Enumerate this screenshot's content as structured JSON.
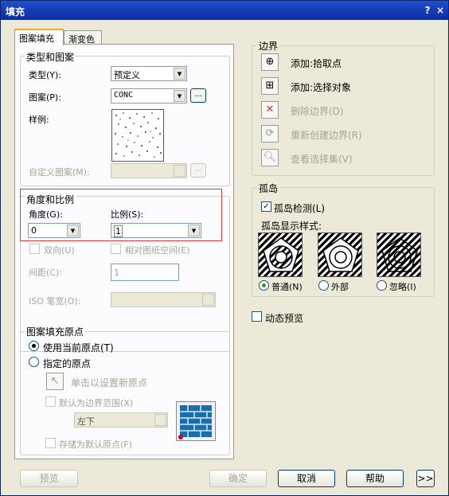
{
  "window": {
    "title": "填充",
    "help_btn": "?",
    "close_btn": "×"
  },
  "tabs": [
    {
      "label": "图案填充"
    },
    {
      "label": "渐变色"
    }
  ],
  "type_pattern": {
    "heading": "类型和图案",
    "type_label": "类型(Y):",
    "type_value": "预定义",
    "pattern_label": "图案(P):",
    "pattern_value": "CONC",
    "browse": "...",
    "sample_label": "样例:",
    "custom_label": "自定义图案(M):"
  },
  "angle_scale": {
    "heading": "角度和比例",
    "angle_label": "角度(G):",
    "angle_value": "0",
    "scale_label": "比例(S):",
    "scale_value": "1",
    "double_label": "双向(U)",
    "relative_label": "相对图纸空间(E)",
    "spacing_label": "间距(C):",
    "spacing_value": "1",
    "iso_label": "ISO 笔宽(O):"
  },
  "origin": {
    "heading": "图案填充原点",
    "use_current": "使用当前原点(T)",
    "specified": "指定的原点",
    "click_set": "单击以设置新原点",
    "default_extent": "默认为边界范围(X)",
    "position_value": "左下",
    "store_default": "存储为默认原点(F)"
  },
  "boundary": {
    "heading": "边界",
    "add_pick": "添加:拾取点",
    "add_select": "添加:选择对象",
    "remove": "删除边界(D)",
    "recreate": "重新创建边界(R)",
    "view_sel": "查看选择集(V)"
  },
  "islands": {
    "heading": "孤岛",
    "detect": "孤岛检测(L)",
    "style_label": "孤岛显示样式:",
    "normal": "普通(N)",
    "outer": "外部",
    "ignore": "忽略(I)"
  },
  "dynamic_preview": "动态预览",
  "buttons": {
    "preview": "预览",
    "ok": "确定",
    "cancel": "取消",
    "help": "帮助",
    "more": ">>"
  },
  "colors": {
    "title_bar": "#0b2d9a",
    "highlight_box": "#d93a3a",
    "dialog_bg": "#ece9d8"
  }
}
